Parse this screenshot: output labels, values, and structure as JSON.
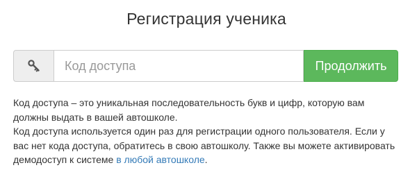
{
  "page": {
    "title": "Регистрация ученика"
  },
  "form": {
    "addon_icon": "key-icon",
    "code_placeholder": "Код доступа",
    "code_value": "",
    "submit_label": "Продолжить"
  },
  "info": {
    "paragraph1_line1": "Код доступа – это уникальная последовательность букв и цифр, которую вам",
    "paragraph1_line2": "должны выдать в вашей автошколе.",
    "paragraph2_line1": "Код доступа используется один раз для регистрации одного пользователя. Если у",
    "paragraph2_line2": "вас нет кода доступа, обратитесь в свою автошколу. Также вы можете активировать",
    "paragraph2_line3_text": "демодоступ к системе ",
    "paragraph2_link": "в любой автошколе",
    "paragraph2_line3_end": "."
  },
  "colors": {
    "button_bg": "#5cb85c",
    "link": "#337ab7",
    "text": "#333333"
  }
}
